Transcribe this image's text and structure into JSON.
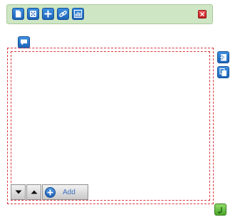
{
  "toolbar": {
    "buttons": [
      {
        "icon": "new-page-icon"
      },
      {
        "icon": "dice-icon"
      },
      {
        "icon": "plus-icon"
      },
      {
        "icon": "link-icon"
      },
      {
        "icon": "chart-icon"
      }
    ],
    "close_icon": "close-icon"
  },
  "comment_icon": "comment-icon",
  "side_buttons": [
    {
      "icon": "add-page-icon"
    },
    {
      "icon": "copy-page-icon"
    }
  ],
  "return_icon": "return-icon",
  "controls": {
    "down_icon": "move-down-icon",
    "up_icon": "move-up-icon",
    "add_label": "Add"
  },
  "colors": {
    "toolbar_bg": "#cfe6c5",
    "accent_blue": "#1d64b9",
    "dashed_border": "#d9363e",
    "close_red": "#c41f1f",
    "green_button": "#4aa62a"
  }
}
